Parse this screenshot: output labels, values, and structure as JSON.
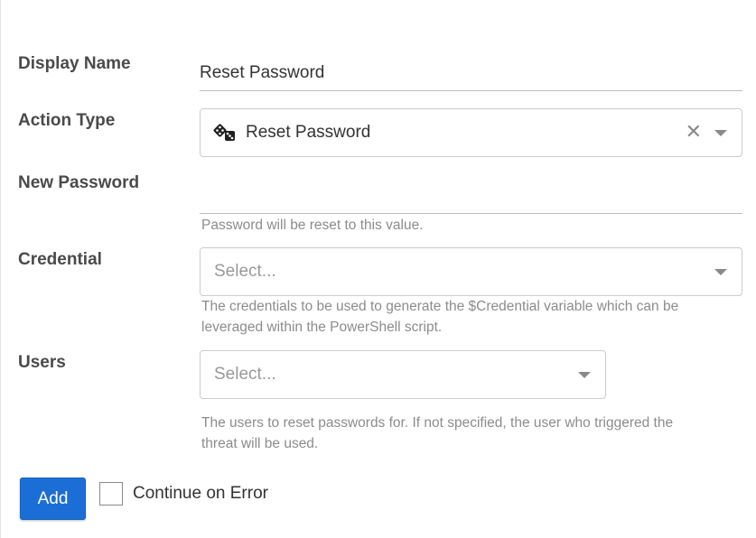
{
  "form": {
    "display_name": {
      "label": "Display Name",
      "value": "Reset Password"
    },
    "action_type": {
      "label": "Action Type",
      "value": "Reset Password",
      "icon": "dice-icon"
    },
    "new_password": {
      "label": "New Password",
      "value": "",
      "help": "Password will be reset to this value."
    },
    "credential": {
      "label": "Credential",
      "placeholder": "Select...",
      "help_line1": "The credentials to be used to generate the $Credential variable which can be",
      "help_line2": "leveraged within the PowerShell script."
    },
    "users": {
      "label": "Users",
      "placeholder": "Select...",
      "help_line1": "The users to reset passwords for. If not specified, the user who triggered the",
      "help_line2": "threat will be used."
    }
  },
  "actions": {
    "add_label": "Add",
    "continue_on_error_label": "Continue on Error",
    "continue_on_error_checked": false
  },
  "colors": {
    "primary_button": "#1b6ed6",
    "label_text": "#4a4a4a",
    "help_text": "#8c8c8c"
  }
}
